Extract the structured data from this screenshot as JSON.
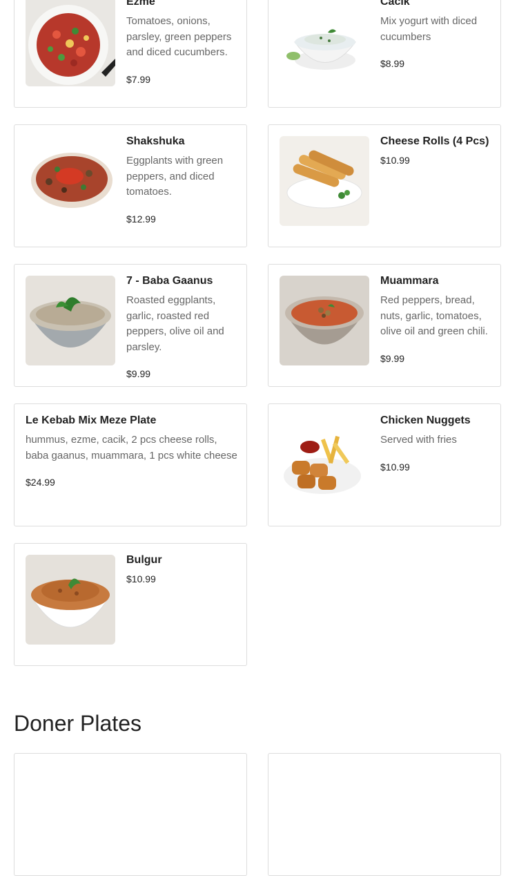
{
  "items": {
    "ezme": {
      "title": "Ezme",
      "desc": "Tomatoes, onions, parsley, green peppers and diced cucumbers.",
      "price": "$7.99"
    },
    "cacik": {
      "title": "Cacik",
      "desc": "Mix yogurt with diced cucumbers",
      "price": "$8.99"
    },
    "shakshuka": {
      "title": "Shakshuka",
      "desc": "Eggplants with green peppers, and diced tomatoes.",
      "price": "$12.99"
    },
    "cheese_rolls": {
      "title": "Cheese Rolls (4 Pcs)",
      "price": "$10.99"
    },
    "baba": {
      "title": "7 - Baba Gaanus",
      "desc": "Roasted eggplants, garlic, roasted red peppers, olive oil and parsley.",
      "price": "$9.99"
    },
    "muammara": {
      "title": "Muammara",
      "desc": "Red peppers, bread, nuts, garlic, tomatoes, olive oil and green chili.",
      "price": "$9.99"
    },
    "mix_meze": {
      "title": "Le Kebab Mix Meze Plate",
      "desc": "hummus, ezme, cacik, 2 pcs cheese rolls, baba gaanus, muammara, 1 pcs white cheese",
      "price": "$24.99"
    },
    "nuggets": {
      "title": "Chicken Nuggets",
      "desc": "Served with fries",
      "price": "$10.99"
    },
    "bulgur": {
      "title": "Bulgur",
      "price": "$10.99"
    }
  },
  "sections": {
    "doner_plates": "Doner Plates"
  }
}
